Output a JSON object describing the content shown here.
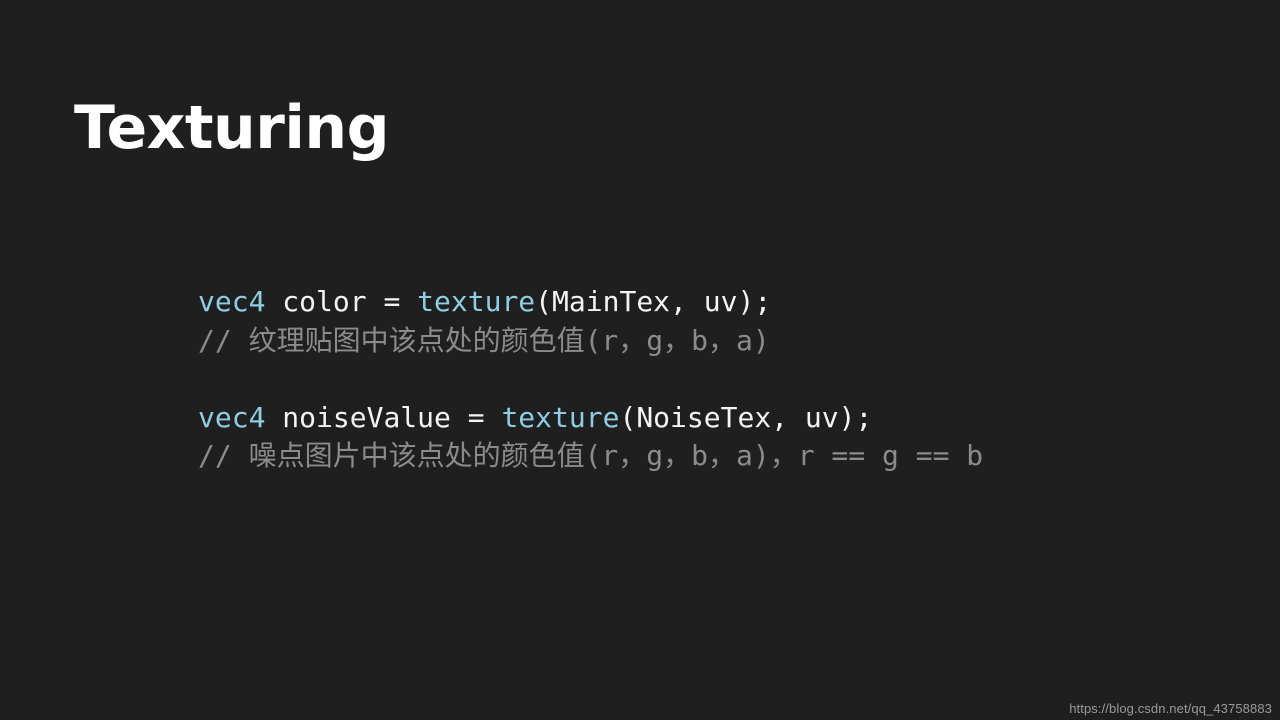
{
  "slide": {
    "title": "Texturing",
    "background_color": "#1f1f1f",
    "title_color": "#ffffff"
  },
  "palette": {
    "keyword_blue": "#8ecde3",
    "plain_white": "#f4f4f4",
    "comment_gray": "#8b8b8b",
    "watermark_gray": "#9a9a9a"
  },
  "code": {
    "language": "glsl",
    "lines": [
      {
        "kind": "code",
        "tokens": [
          {
            "type": "type",
            "text": "vec4"
          },
          {
            "type": "plain",
            "text": " color = "
          },
          {
            "type": "fn",
            "text": "texture"
          },
          {
            "type": "plain",
            "text": "(MainTex, uv);"
          }
        ],
        "plain_text": "vec4 color = texture(MainTex, uv);"
      },
      {
        "kind": "comment",
        "tokens": [
          {
            "type": "comment",
            "text": "// 纹理贴图中该点处的颜色值(r，g，b，a)"
          }
        ],
        "plain_text": "// 纹理贴图中该点处的颜色值(r，g，b，a)"
      },
      {
        "kind": "blank",
        "tokens": [],
        "plain_text": ""
      },
      {
        "kind": "code",
        "tokens": [
          {
            "type": "type",
            "text": "vec4"
          },
          {
            "type": "plain",
            "text": " noiseValue = "
          },
          {
            "type": "fn",
            "text": "texture"
          },
          {
            "type": "plain",
            "text": "(NoiseTex, uv);"
          }
        ],
        "plain_text": "vec4 noiseValue = texture(NoiseTex, uv);"
      },
      {
        "kind": "comment",
        "tokens": [
          {
            "type": "comment",
            "text": "// 噪点图片中该点处的颜色值(r，g，b，a)，r == g == b"
          }
        ],
        "plain_text": "// 噪点图片中该点处的颜色值(r，g，b，a)，r == g == b"
      }
    ]
  },
  "watermark": {
    "text": "https://blog.csdn.net/qq_43758883"
  }
}
